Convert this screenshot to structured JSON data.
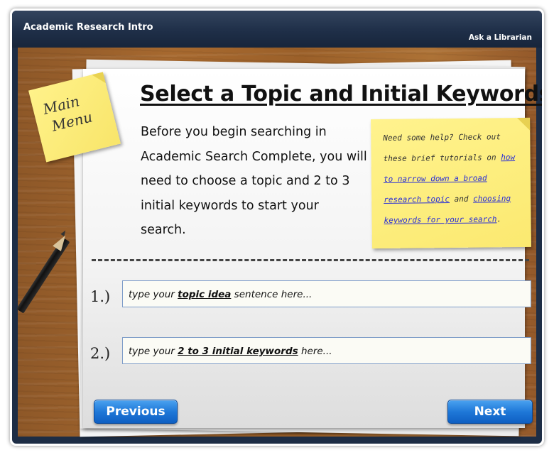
{
  "titlebar": {
    "app_title": "Academic Research Intro",
    "ask_link": "Ask a Librarian"
  },
  "main_menu_note": {
    "line1": "Main",
    "line2": "Menu"
  },
  "page_title": "Select a Topic and Initial Keywords",
  "intro_text": "Before you begin searching in Academic Search Complete, you will need to choose a topic and 2 to 3 initial keywords to start your search.",
  "help_note": {
    "prefix": "Need some help? Check out these brief tutorials on",
    "link1": "how to narrow down a broad research topic",
    "middle": "and",
    "link2": "choosing keywords for your search",
    "suffix": "."
  },
  "steps": [
    {
      "label": "1.)",
      "placeholder_pre": "type your ",
      "placeholder_bold": "topic idea",
      "placeholder_post": " sentence here..."
    },
    {
      "label": "2.)",
      "placeholder_pre": "type your ",
      "placeholder_bold": "2 to 3 initial keywords",
      "placeholder_post": " here..."
    }
  ],
  "buttons": {
    "previous": "Previous",
    "next": "Next"
  },
  "colors": {
    "titlebar": "#1f2f48",
    "sticky_note": "#fbe970",
    "link": "#2a2fd6",
    "button": "#1f78d8",
    "field_border": "#7d9cc8"
  },
  "icons": {
    "pencil": "pencil-icon"
  }
}
